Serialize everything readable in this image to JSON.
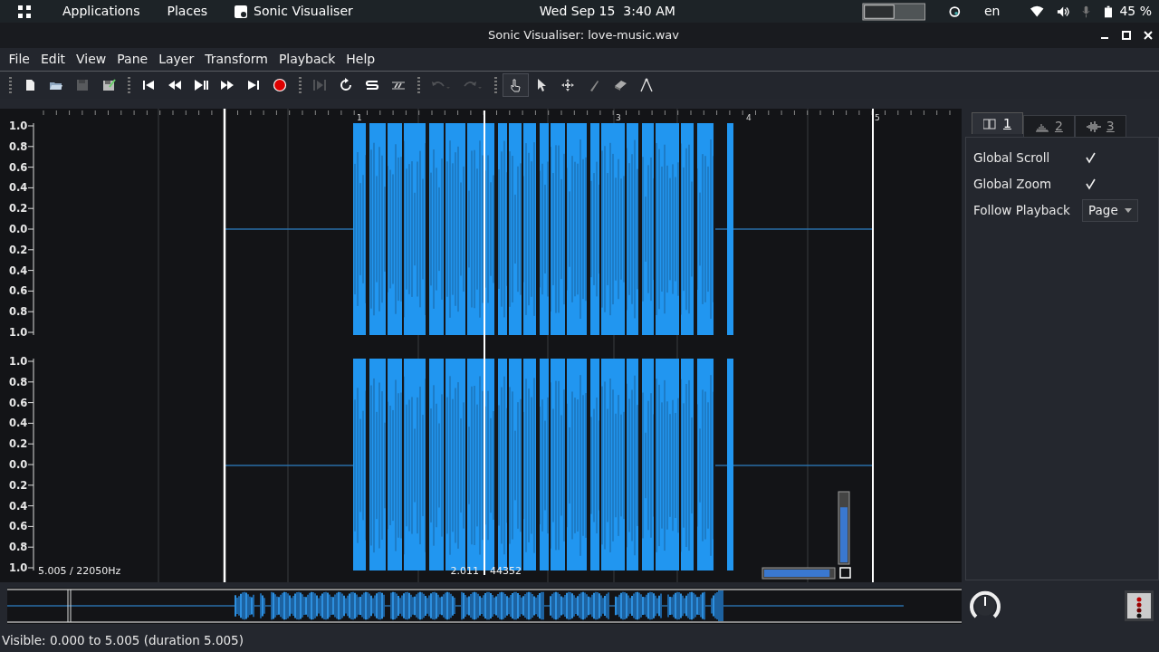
{
  "top_bar": {
    "activities": "Applications",
    "places": "Places",
    "app": "Sonic Visualiser",
    "clock": "Wed Sep 15  3:40 AM",
    "language": "en",
    "battery": "45 %"
  },
  "window": {
    "title": "Sonic Visualiser: love-music.wav"
  },
  "menu": [
    "File",
    "Edit",
    "View",
    "Pane",
    "Layer",
    "Transform",
    "Playback",
    "Help"
  ],
  "toolbar": [
    {
      "kind": "new",
      "disabled": false
    },
    {
      "kind": "open",
      "disabled": false
    },
    {
      "kind": "save",
      "disabled": true
    },
    {
      "kind": "save-as",
      "disabled": false
    },
    {
      "kind": "sep"
    },
    {
      "kind": "rewind-start",
      "disabled": false
    },
    {
      "kind": "rewind",
      "disabled": false
    },
    {
      "kind": "play-pause",
      "disabled": false
    },
    {
      "kind": "forward",
      "disabled": false
    },
    {
      "kind": "forward-end",
      "disabled": false
    },
    {
      "kind": "record",
      "disabled": false
    },
    {
      "kind": "sep"
    },
    {
      "kind": "play-selection",
      "disabled": true
    },
    {
      "kind": "loop",
      "disabled": false
    },
    {
      "kind": "solo",
      "disabled": false
    },
    {
      "kind": "align",
      "disabled": false
    },
    {
      "kind": "sep"
    },
    {
      "kind": "undo",
      "disabled": true
    },
    {
      "kind": "redo",
      "disabled": true
    },
    {
      "kind": "sep"
    }
  ],
  "tools": [
    {
      "kind": "navigate",
      "selected": true
    },
    {
      "kind": "select",
      "selected": false
    },
    {
      "kind": "move",
      "selected": false
    },
    {
      "kind": "draw",
      "selected": false
    },
    {
      "kind": "erase",
      "selected": false
    },
    {
      "kind": "measure",
      "selected": false
    }
  ],
  "pane": {
    "ruler_labels": [
      "1",
      "3",
      "4",
      "5"
    ],
    "channels": [
      {
        "scale": [
          "1.0",
          "0.8",
          "0.6",
          "0.4",
          "0.2",
          "0.0",
          "0.2",
          "0.4",
          "0.6",
          "0.8",
          "1.0"
        ]
      },
      {
        "scale": [
          "1.0",
          "0.8",
          "0.6",
          "0.4",
          "0.2",
          "0.0",
          "0.2",
          "0.4",
          "0.6",
          "0.8",
          "1.0"
        ]
      }
    ],
    "info_left": "5.005 / 22050Hz",
    "info_time": "2.011",
    "info_frame": "44352",
    "vertical_zoom": {
      "level": 0.8
    },
    "horizontal_zoom": {
      "level": 0.95
    }
  },
  "property_tabs": [
    {
      "label": "1",
      "kind": "panes",
      "selected": true
    },
    {
      "label": "2",
      "kind": "spectrum",
      "selected": false
    },
    {
      "label": "3",
      "kind": "wave",
      "selected": false
    }
  ],
  "properties": [
    {
      "kind": "check",
      "label": "Global Scroll",
      "checked": true
    },
    {
      "kind": "check",
      "label": "Global Zoom",
      "checked": true
    },
    {
      "kind": "select",
      "label": "Follow Playback",
      "value": "Page"
    }
  ],
  "status_bar": "Visible: 0.000 to 5.005 (duration 5.005)"
}
